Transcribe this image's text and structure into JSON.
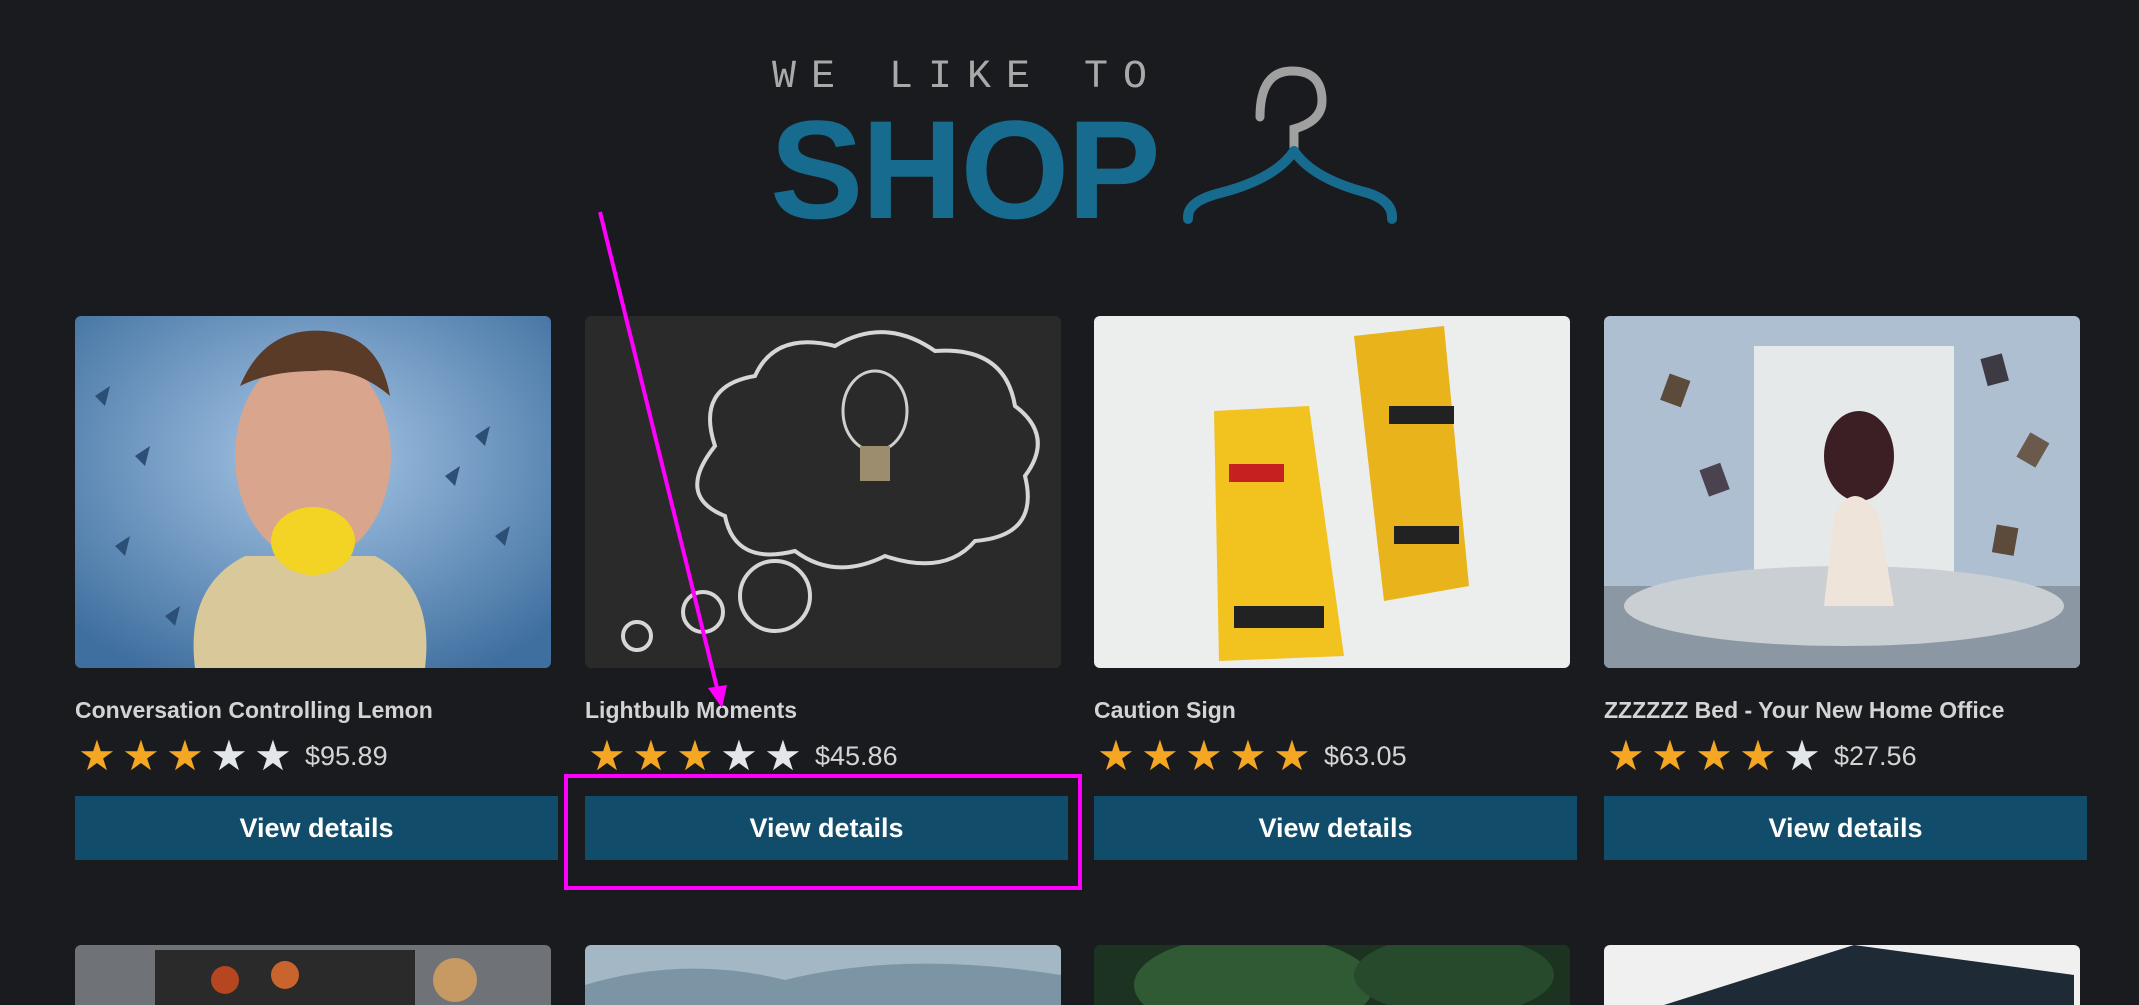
{
  "logo": {
    "tagline": "WE LIKE TO",
    "word": "SHOP",
    "icon": "hanger-icon"
  },
  "colors": {
    "background": "#1a1b1e",
    "logo_blue": "#176b8e",
    "button": "#114c6a",
    "star_full": "#f5a623",
    "star_empty": "#e4e7ea",
    "annotation": "#ff00ff"
  },
  "products": [
    {
      "title": "Conversation Controlling Lemon",
      "rating": 3,
      "price": "$95.89",
      "button": "View details"
    },
    {
      "title": "Lightbulb Moments",
      "rating": 3,
      "price": "$45.86",
      "button": "View details"
    },
    {
      "title": "Caution Sign",
      "rating": 5,
      "price": "$63.05",
      "button": "View details"
    },
    {
      "title": "ZZZZZZ Bed - Your New Home Office",
      "rating": 4,
      "price": "$27.56",
      "button": "View details"
    }
  ],
  "rating_max": 5
}
